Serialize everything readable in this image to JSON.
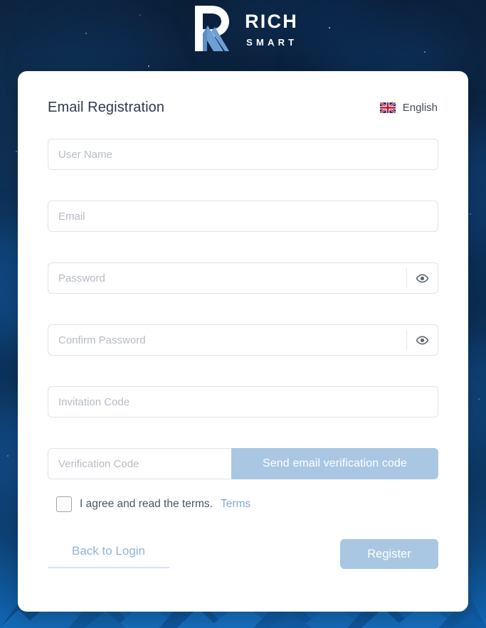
{
  "brand": {
    "name_primary": "RICH",
    "name_secondary": "SMART",
    "logo_icon": "rich-smart-logo",
    "accent_color": "#7fa9d6",
    "logo_blue": "#6e9fd4"
  },
  "header": {
    "title": "Email Registration",
    "language": {
      "flag_icon": "uk-flag-icon",
      "label": "English"
    }
  },
  "form": {
    "fields": [
      {
        "name": "user-name",
        "placeholder": "User Name",
        "value": "",
        "type": "text",
        "icon": null
      },
      {
        "name": "email",
        "placeholder": "Email",
        "value": "",
        "type": "text",
        "icon": null
      },
      {
        "name": "password",
        "placeholder": "Password",
        "value": "",
        "type": "password",
        "icon": "eye-icon"
      },
      {
        "name": "confirm-password",
        "placeholder": "Confirm Password",
        "value": "",
        "type": "password",
        "icon": "eye-icon"
      },
      {
        "name": "invitation-code",
        "placeholder": "Invitation Code",
        "value": "",
        "type": "text",
        "icon": null
      }
    ],
    "verification": {
      "placeholder": "Verification Code",
      "value": "",
      "send_button_label": "Send email verification code",
      "send_button_color": "#a9c7e3"
    },
    "terms": {
      "checked": false,
      "text": "I agree and read the terms.",
      "link_label": "Terms",
      "link_color": "#7fa9d6"
    },
    "actions": {
      "back_label": "Back to Login",
      "register_label": "Register",
      "register_color": "#a9c7e3"
    }
  },
  "background": {
    "base_color": "#0a1b2e",
    "bottom_color": "#0f4f8f"
  }
}
